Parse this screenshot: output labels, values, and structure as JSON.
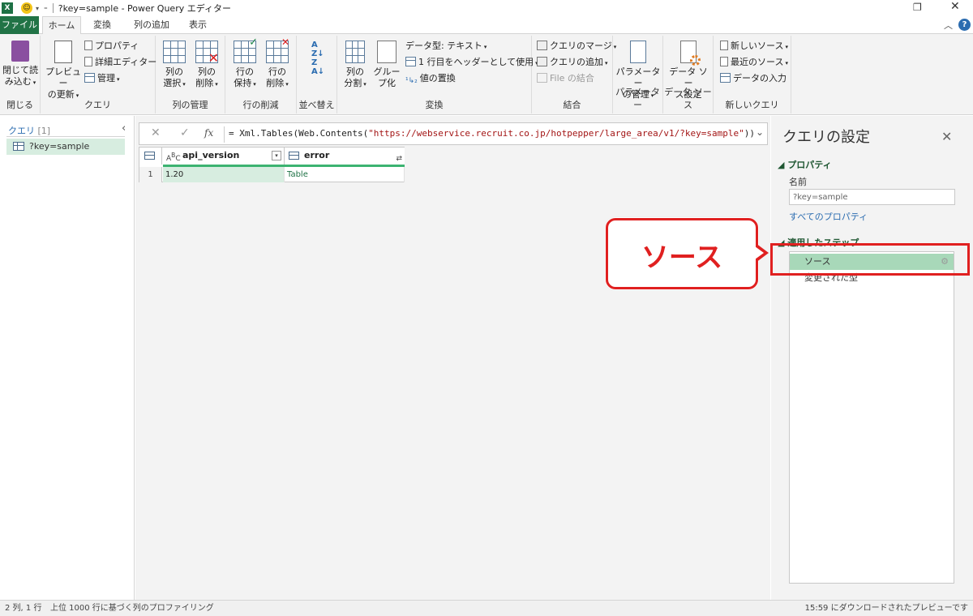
{
  "titlebar": {
    "title": "?key=sample - Power Query エディター"
  },
  "tabs": {
    "file": "ファイル",
    "home": "ホーム",
    "transform": "変換",
    "add_column": "列の追加",
    "view": "表示"
  },
  "ribbon": {
    "close_group": {
      "label": "閉じる",
      "close_load_l1": "閉じて読",
      "close_load_l2": "み込む"
    },
    "query_group": {
      "label": "クエリ",
      "refresh_l1": "プレビュー",
      "refresh_l2": "の更新",
      "properties": "プロパティ",
      "advanced_editor": "詳細エディター",
      "manage": "管理"
    },
    "manage_cols_group": {
      "label": "列の管理",
      "choose_l1": "列の",
      "choose_l2": "選択",
      "remove_l1": "列の",
      "remove_l2": "削除"
    },
    "reduce_rows_group": {
      "label": "行の削減",
      "keep_l1": "行の",
      "keep_l2": "保持",
      "remove_l1": "行の",
      "remove_l2": "削除"
    },
    "sort_group": {
      "label": "並べ替え"
    },
    "transform_group": {
      "label": "変換",
      "split_l1": "列の",
      "split_l2": "分割",
      "group_l1": "グルー",
      "group_l2": "プ化",
      "data_type": "データ型: テキスト",
      "first_row_header": "1 行目をヘッダーとして使用",
      "replace_values": "値の置換"
    },
    "combine_group": {
      "label": "結合",
      "merge_queries": "クエリのマージ",
      "append_queries": "クエリの追加",
      "combine_files": "File の結合"
    },
    "params_group": {
      "label": "パラメーター",
      "manage_l1": "パラメーター",
      "manage_l2": "の管理"
    },
    "datasource_group": {
      "label": "データ ソース",
      "settings_l1": "データ ソー",
      "settings_l2": "ス設定"
    },
    "newquery_group": {
      "label": "新しいクエリ",
      "new_source": "新しいソース",
      "recent_sources": "最近のソース",
      "enter_data": "データの入力"
    }
  },
  "left_pane": {
    "title": "クエリ",
    "count": "[1]",
    "items": [
      {
        "label": "?key=sample"
      }
    ]
  },
  "formula_bar": {
    "prefix": "= Xml.Tables(Web.Contents(",
    "url": "\"https://webservice.recruit.co.jp/hotpepper/large_area/v1/?key=sample\"",
    "suffix": "))"
  },
  "grid": {
    "columns": [
      {
        "name": "api_version",
        "type": "ABC"
      },
      {
        "name": "error",
        "type": "table"
      }
    ],
    "rows": [
      {
        "num": "1",
        "cells": [
          "1.20",
          "Table"
        ]
      }
    ]
  },
  "right_pane": {
    "title": "クエリの設定",
    "properties_heading": "プロパティ",
    "name_label": "名前",
    "name_value": "?key=sample",
    "all_properties_link": "すべてのプロパティ",
    "applied_steps_heading": "適用したステップ",
    "steps": [
      {
        "label": "ソース",
        "selected": true
      },
      {
        "label": "変更された型",
        "selected": false
      }
    ]
  },
  "callout": {
    "text": "ソース"
  },
  "status_bar": {
    "dims": "2 列, 1 行",
    "profiling": "上位 1000 行に基づく列のプロファイリング",
    "download_time": "15:59 にダウンロードされたプレビューです"
  },
  "colors": {
    "accent": "#217346",
    "highlight_red": "#e02020",
    "selected_green": "#a8d8b9"
  }
}
